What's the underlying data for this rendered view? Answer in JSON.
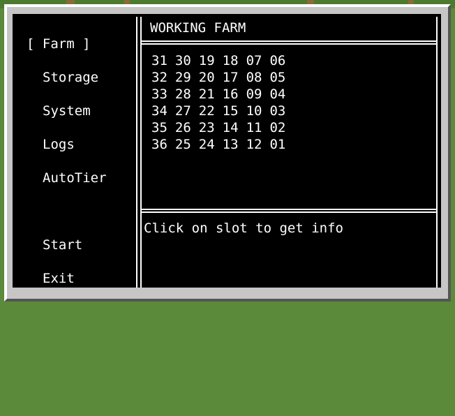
{
  "menu": {
    "items": [
      {
        "label": "[ Farm ]",
        "name": "menu-item-farm"
      },
      {
        "label": "Storage",
        "name": "menu-item-storage"
      },
      {
        "label": "System",
        "name": "menu-item-system"
      },
      {
        "label": "Logs",
        "name": "menu-item-logs"
      },
      {
        "label": "AutoTier",
        "name": "menu-item-autotier"
      },
      {
        "label": "Start",
        "name": "menu-item-start"
      },
      {
        "label": "Exit",
        "name": "menu-item-exit"
      }
    ]
  },
  "panel": {
    "title": "WORKING FARM",
    "info_text": "Click on slot to get info"
  },
  "farm_grid": [
    [
      "31",
      "30",
      "19",
      "18",
      "07",
      "06"
    ],
    [
      "32",
      "29",
      "20",
      "17",
      "08",
      "05"
    ],
    [
      "33",
      "28",
      "21",
      "16",
      "09",
      "04"
    ],
    [
      "34",
      "27",
      "22",
      "15",
      "10",
      "03"
    ],
    [
      "35",
      "26",
      "23",
      "14",
      "11",
      "02"
    ],
    [
      "36",
      "25",
      "24",
      "13",
      "12",
      "01"
    ]
  ],
  "colors": {
    "screen_background": "#000000",
    "text": "#ffffff",
    "frame": "#c6c6c6"
  }
}
